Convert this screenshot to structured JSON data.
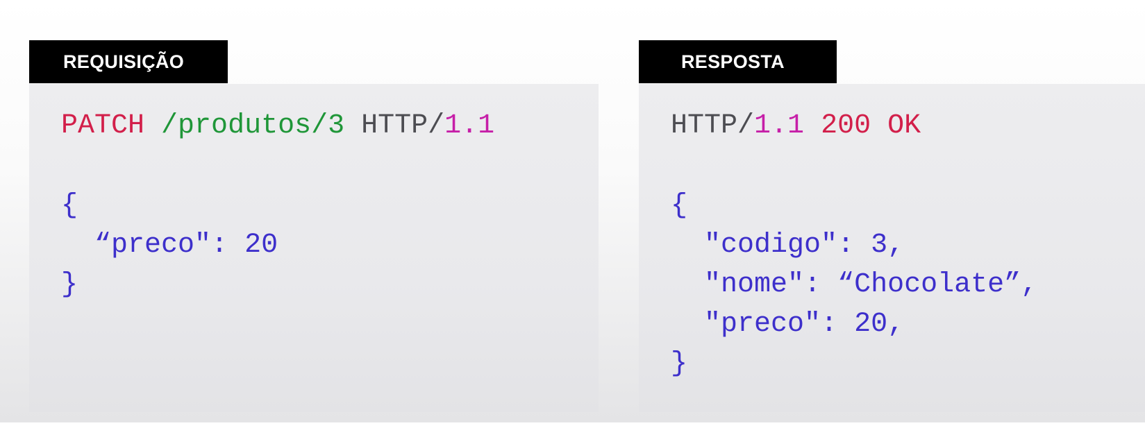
{
  "request": {
    "tab_label": "REQUISIÇÃO",
    "method": "PATCH",
    "path": "/produtos/3",
    "protocol": "HTTP/",
    "version": "1.1",
    "body_open": "{",
    "field_key": "“preco\"",
    "field_sep": ": ",
    "field_value": "20",
    "body_close": "}"
  },
  "response": {
    "tab_label": "RESPOSTA",
    "protocol": "HTTP/",
    "version": "1.1",
    "status": "200 OK",
    "body_open": "{",
    "fields": [
      {
        "key": "\"codigo\"",
        "sep": ": ",
        "value": "3",
        "trail": ","
      },
      {
        "key": "\"nome\"",
        "sep": ": ",
        "value": "“Chocolate”",
        "trail": ","
      },
      {
        "key": "\"preco\"",
        "sep": ": ",
        "value": "20",
        "trail": ","
      }
    ],
    "body_close": "}"
  },
  "colors": {
    "method": "#d21f4a",
    "path": "#1f9638",
    "protocol": "#4d4d52",
    "version": "#c61fa8",
    "json": "#3d2fcb",
    "tab_bg": "#000000",
    "panel_bg": "#ebebed"
  }
}
